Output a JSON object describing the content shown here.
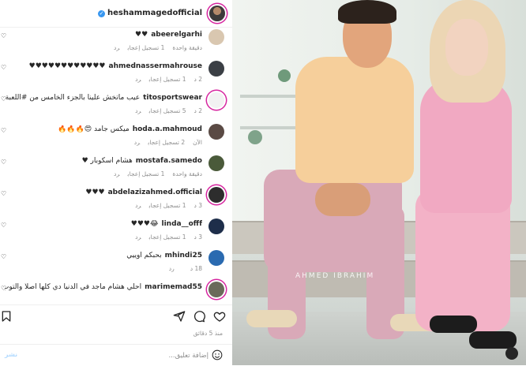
{
  "post": {
    "username": "heshammagedofficial",
    "watermark": "AHMED IBRAHIM",
    "time_ago": "منذ 5 دقائق"
  },
  "comments": [
    {
      "user": "abeerelgarhi",
      "text": "♥♥",
      "time": "دقيقة واحدة",
      "likes": "1 تسجيل إعجاب",
      "reply": "رد",
      "avatar_color": "#d9c7b0"
    },
    {
      "user": "ahmednassermahrouse",
      "text": "♥♥♥♥♥♥♥♥♥♥♥♥",
      "time": "2 د",
      "likes": "1 تسجيل إعجاب",
      "reply": "رد",
      "avatar_color": "#3b3f45"
    },
    {
      "user": "titosportswear",
      "text": "عيب ماتخش علينا بالجزء الخامس من #اللعبة ♥♥",
      "time": "2 د",
      "likes": "5 تسجيل إعجاب",
      "reply": "رد",
      "avatar_color": "#f2f2f2"
    },
    {
      "user": "hoda.a.mahmoud",
      "text": "ميكس جامد 😍🔥🔥🔥",
      "time": "الآن",
      "likes": "2 تسجيل إعجاب",
      "reply": "رد",
      "avatar_color": "#5a4a44"
    },
    {
      "user": "mostafa.samedo",
      "text": "هشام اسكوبار ♥",
      "time": "دقيقة واحدة",
      "likes": "1 تسجيل إعجاب",
      "reply": "رد",
      "avatar_color": "#4a5a3a"
    },
    {
      "user": "abdelazizahmed.official",
      "text": "♥♥♥",
      "time": "3 د",
      "likes": "1 تسجيل إعجاب",
      "reply": "رد",
      "avatar_color": "#2d2d2d"
    },
    {
      "user": "linda__offf",
      "text": "😂♥♥♥",
      "time": "3 د",
      "likes": "1 تسجيل إعجاب",
      "reply": "رد",
      "avatar_color": "#1e2e4a"
    },
    {
      "user": "mhindi25",
      "text": "بحبكم اوييي",
      "time": "18 د",
      "likes": "",
      "reply": "رد",
      "avatar_color": "#2a6ab0"
    },
    {
      "user": "marimemad55",
      "text": "احلي هشام ماجد في الدنيا دي كلها اصلا والتوب كدة كدة ♥♥",
      "time": "",
      "likes": "",
      "reply": "",
      "avatar_color": "#6a6a5a"
    }
  ],
  "composer": {
    "placeholder": "إضافة تعليق...",
    "post_label": "نشر"
  },
  "colors": {
    "verified": "#3897f0",
    "story_ring": "#d6249f",
    "muted_text": "#8e8e8e"
  },
  "icons": [
    "heart-icon",
    "comment-icon",
    "share-icon",
    "bookmark-icon",
    "emoji-icon",
    "verified-badge-icon",
    "more-options-icon"
  ]
}
